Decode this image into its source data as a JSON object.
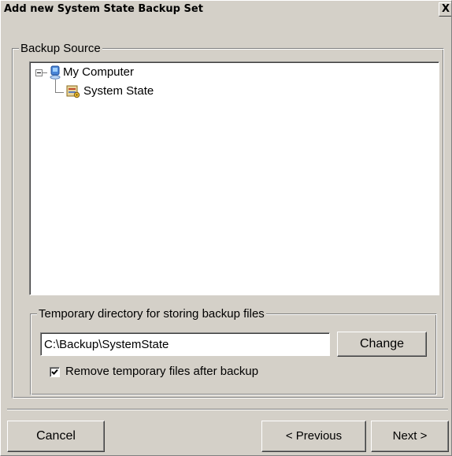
{
  "window": {
    "title": "Add new  System State Backup Set",
    "close_label": "X"
  },
  "backup_source": {
    "legend": "Backup Source",
    "tree": [
      {
        "label": "My Computer",
        "icon": "computer-icon",
        "expanded": true
      },
      {
        "label": "System State",
        "icon": "system-state-icon",
        "parent": "My Computer"
      }
    ]
  },
  "temp_dir": {
    "legend": "Temporary directory for storing backup files",
    "path": "C:\\Backup\\SystemState",
    "change_label": "Change",
    "remove_label": "Remove temporary files after backup",
    "remove_checked": true
  },
  "buttons": {
    "cancel": "Cancel",
    "previous": "< Previous",
    "next": "Next >"
  },
  "colors": {
    "dialog_face": "#d4d0c8",
    "panel_background": "#ffffff"
  }
}
